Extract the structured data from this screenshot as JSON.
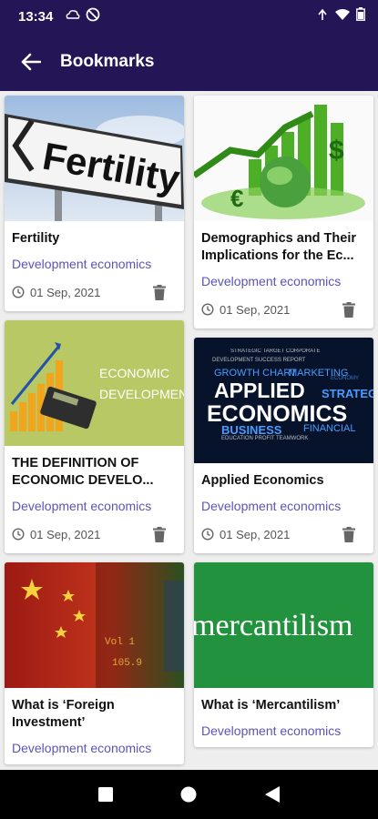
{
  "status_bar": {
    "time": "13:34"
  },
  "app_bar": {
    "title": "Bookmarks"
  },
  "bookmarks": [
    {
      "title": "Fertility",
      "category": "Development economics",
      "date": "01 Sep, 2021",
      "image_text": "Fertility"
    },
    {
      "title": "Demographics and Their Implications for the Ec...",
      "category": "Development economics",
      "date": "01 Sep, 2021"
    },
    {
      "title": "THE DEFINITION OF ECONOMIC DEVELO...",
      "category": "Development economics",
      "date": "01 Sep, 2021",
      "image_text": "ECONOMIC DEVELOPMENT"
    },
    {
      "title": "Applied Economics",
      "category": "Development economics",
      "date": "01 Sep, 2021",
      "image_text": "APPLIED ECONOMICS"
    },
    {
      "title": "What is ‘Foreign Investment’",
      "category": "Development economics",
      "date": ""
    },
    {
      "title": "What is ‘Mercantilism’",
      "category": "Development economics",
      "date": "",
      "image_text": "mercantilism"
    }
  ],
  "colors": {
    "app_bar": "#241656",
    "category_text": "#5b54b8",
    "nav_bar": "#000000"
  },
  "icons": [
    "back-arrow-icon",
    "clock-icon",
    "trash-icon",
    "wifi-icon",
    "signal-icon",
    "battery-icon",
    "square-nav-icon",
    "circle-nav-icon",
    "triangle-nav-icon"
  ]
}
